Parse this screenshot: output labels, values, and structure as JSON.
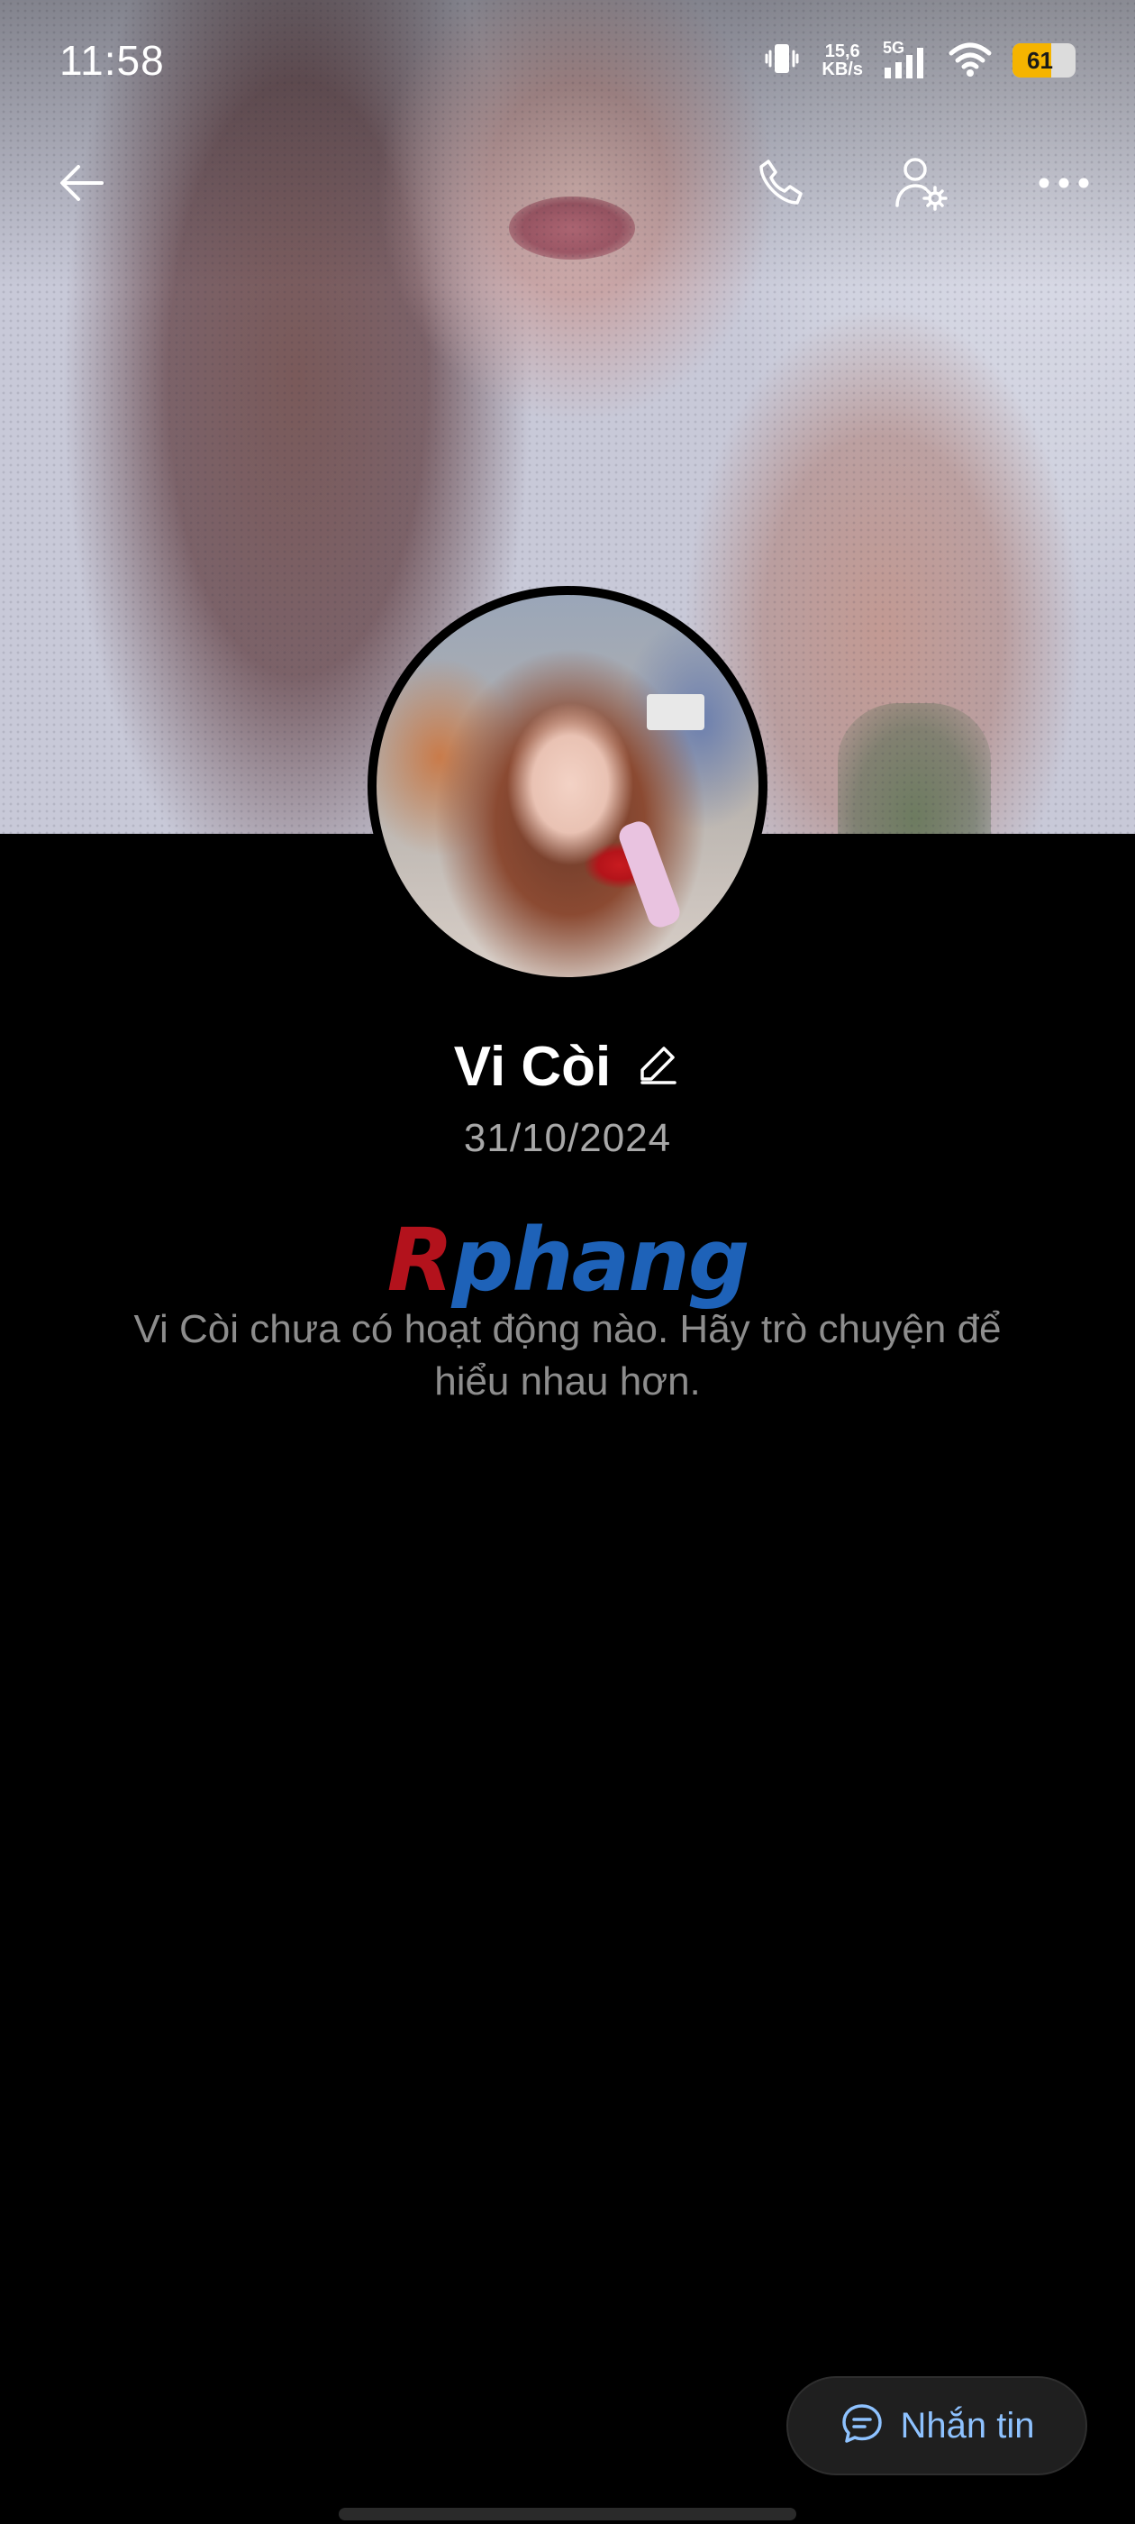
{
  "status_bar": {
    "time": "11:58",
    "net_speed_value": "15,6",
    "net_speed_unit": "KB/s",
    "network_type": "5G",
    "battery_level": "61",
    "battery_fraction": 0.61,
    "battery_color": "#f5b400"
  },
  "header": {
    "back_icon": "arrow-left-icon",
    "call_icon": "phone-icon",
    "settings_icon": "user-settings-icon",
    "more_icon": "more-horizontal-icon"
  },
  "profile": {
    "name": "Vi Còi",
    "edit_icon": "pencil-icon",
    "date": "31/10/2024"
  },
  "watermark": {
    "first_letter": "R",
    "rest": "phang"
  },
  "empty_state": {
    "message": "Vi Còi chưa có hoạt động nào. Hãy trò chuyện để hiểu nhau hơn."
  },
  "fab": {
    "label": "Nhắn tin",
    "icon": "chat-bubble-icon",
    "accent": "#8ec2ff"
  }
}
